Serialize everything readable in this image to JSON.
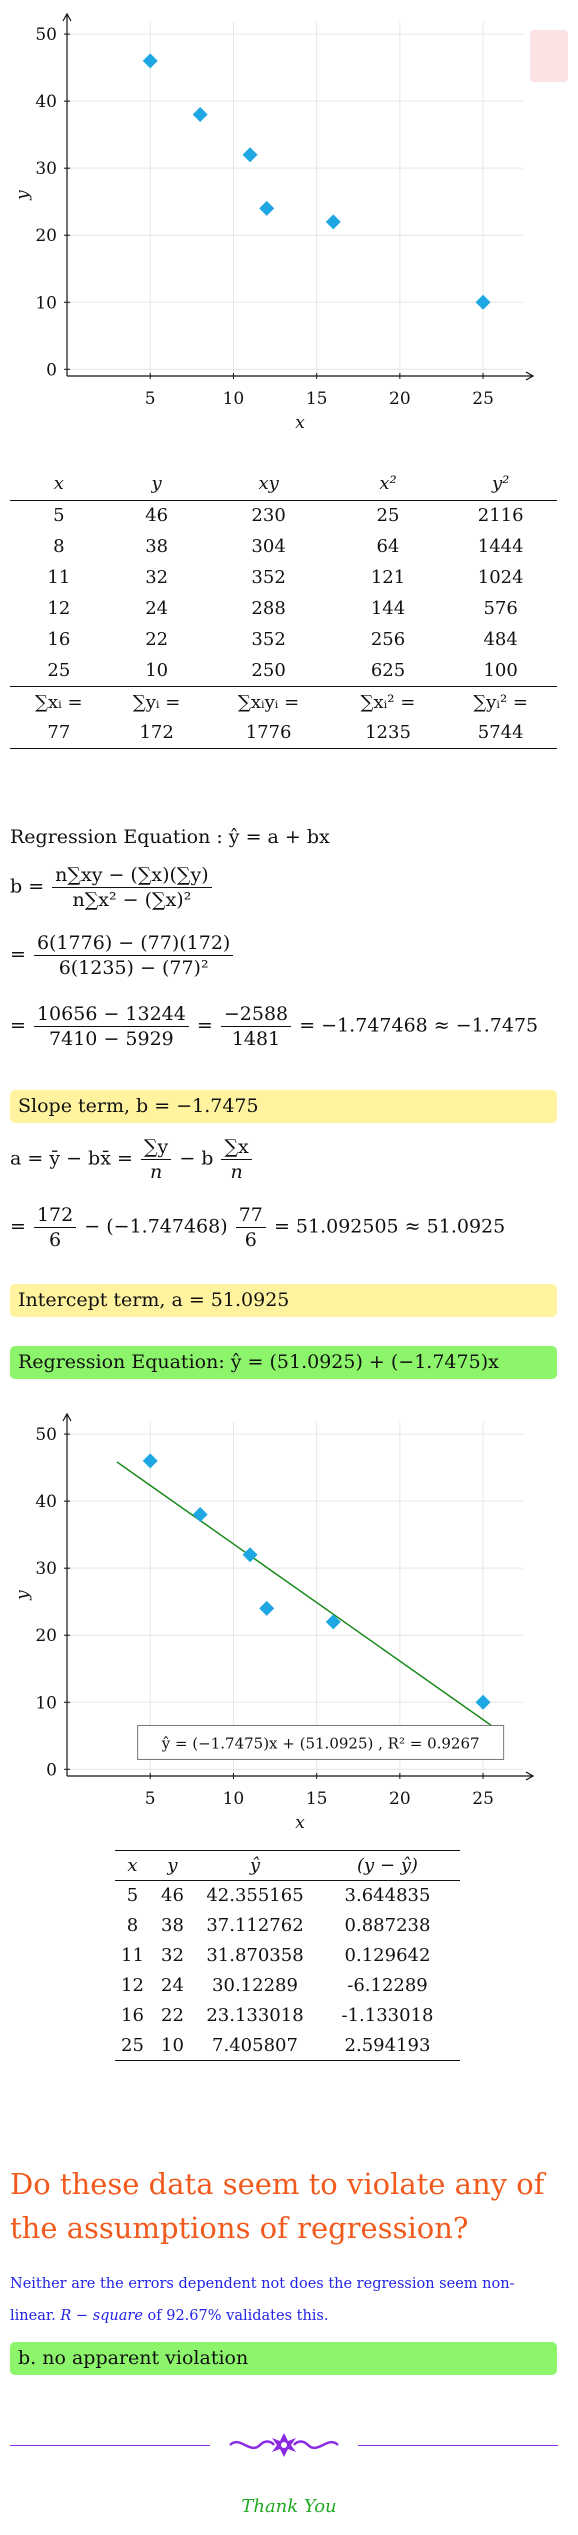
{
  "chart_data": [
    {
      "type": "scatter",
      "x": [
        5,
        8,
        11,
        12,
        16,
        25
      ],
      "y": [
        46,
        38,
        32,
        24,
        22,
        10
      ],
      "xlabel": "x",
      "ylabel": "y",
      "xticks": [
        5,
        10,
        15,
        20,
        25
      ],
      "yticks": [
        0,
        10,
        20,
        30,
        40,
        50
      ],
      "xlim": [
        0,
        28
      ],
      "ylim": [
        -1,
        53
      ],
      "grid": true,
      "marker_color": "#1fa7e3"
    },
    {
      "type": "scatter",
      "x": [
        5,
        8,
        11,
        12,
        16,
        25
      ],
      "y": [
        46,
        38,
        32,
        24,
        22,
        10
      ],
      "xlabel": "x",
      "ylabel": "y",
      "xticks": [
        5,
        10,
        15,
        20,
        25
      ],
      "yticks": [
        0,
        10,
        20,
        30,
        40,
        50
      ],
      "xlim": [
        0,
        28
      ],
      "ylim": [
        -1,
        53
      ],
      "grid": true,
      "marker_color": "#1fa7e3",
      "line": {
        "slope": -1.7475,
        "intercept": 51.0925,
        "x_range": [
          3,
          26
        ],
        "color": "#1a8a1a"
      },
      "annotation": "ŷ = (−1.7475)x + (51.0925) , R² = 0.9267"
    }
  ],
  "table1": {
    "headers": [
      "x",
      "y",
      "xy",
      "x²",
      "y²"
    ],
    "rows": [
      [
        "5",
        "46",
        "230",
        "25",
        "2116"
      ],
      [
        "8",
        "38",
        "304",
        "64",
        "1444"
      ],
      [
        "11",
        "32",
        "352",
        "121",
        "1024"
      ],
      [
        "12",
        "24",
        "288",
        "144",
        "576"
      ],
      [
        "16",
        "22",
        "352",
        "256",
        "484"
      ],
      [
        "25",
        "10",
        "250",
        "625",
        "100"
      ]
    ],
    "sum_labels": [
      "∑xᵢ =",
      "∑yᵢ =",
      "∑xᵢyᵢ =",
      "∑xᵢ² =",
      "∑yᵢ² ="
    ],
    "sums": [
      "77",
      "172",
      "1776",
      "1235",
      "5744"
    ]
  },
  "regression": {
    "title": "Regression Equation : ŷ = a + bx",
    "b_lhs": "b =",
    "b_formula_num": "n∑xy − (∑x)(∑y)",
    "b_formula_den": "n∑x² − (∑x)²",
    "b_sub_num": "6(1776) − (77)(172)",
    "b_sub_den": "6(1235) − (77)²",
    "b_step_num1": "10656 − 13244",
    "b_step_den1": "7410 − 5929",
    "b_step_num2": "−2588",
    "b_step_den2": "1481",
    "b_result": "= −1.747468 ≈ −1.7475",
    "slope_box": "Slope term, b = −1.7475",
    "a_lhs": "a = ȳ − bx̄ =",
    "a_f1_num": "∑y",
    "a_f1_den": "n",
    "a_minus_b": "− b",
    "a_f2_num": "∑x",
    "a_f2_den": "n",
    "a_sub_num1": "172",
    "a_sub_den1": "6",
    "a_sub_mid": "− (−1.747468)",
    "a_sub_num2": "77",
    "a_sub_den2": "6",
    "a_result": "= 51.092505 ≈ 51.0925",
    "intercept_box": "Intercept term, a = 51.0925",
    "equation_box": "Regression Equation: ŷ = (51.0925) + (−1.7475)x"
  },
  "table2": {
    "headers": [
      "x",
      "y",
      "ŷ",
      "(y − ŷ)"
    ],
    "rows": [
      [
        "5",
        "46",
        "42.355165",
        "3.644835"
      ],
      [
        "8",
        "38",
        "37.112762",
        "0.887238"
      ],
      [
        "11",
        "32",
        "31.870358",
        "0.129642"
      ],
      [
        "12",
        "24",
        "30.12289",
        "-6.12289"
      ],
      [
        "16",
        "22",
        "23.133018",
        "-1.133018"
      ],
      [
        "25",
        "10",
        "7.405807",
        "2.594193"
      ]
    ]
  },
  "question": "Do these data seem to violate any of the assumptions of regression?",
  "explanation_line1": "Neither are the errors dependent not does the regression seem non-",
  "explanation_line2_a": "linear. ",
  "explanation_line2_b": "R − square",
  "explanation_line2_c": " of 92.67% validates this.",
  "answer_box": "b. no apparent violation",
  "footer": "Thank You",
  "colors": {
    "question": "#f25a1d",
    "explanation": "#2323e6",
    "footer": "#22aa22",
    "divider": "#8a2be2",
    "yellow_box": "#fff3a0",
    "green_box": "#8cf56b"
  }
}
